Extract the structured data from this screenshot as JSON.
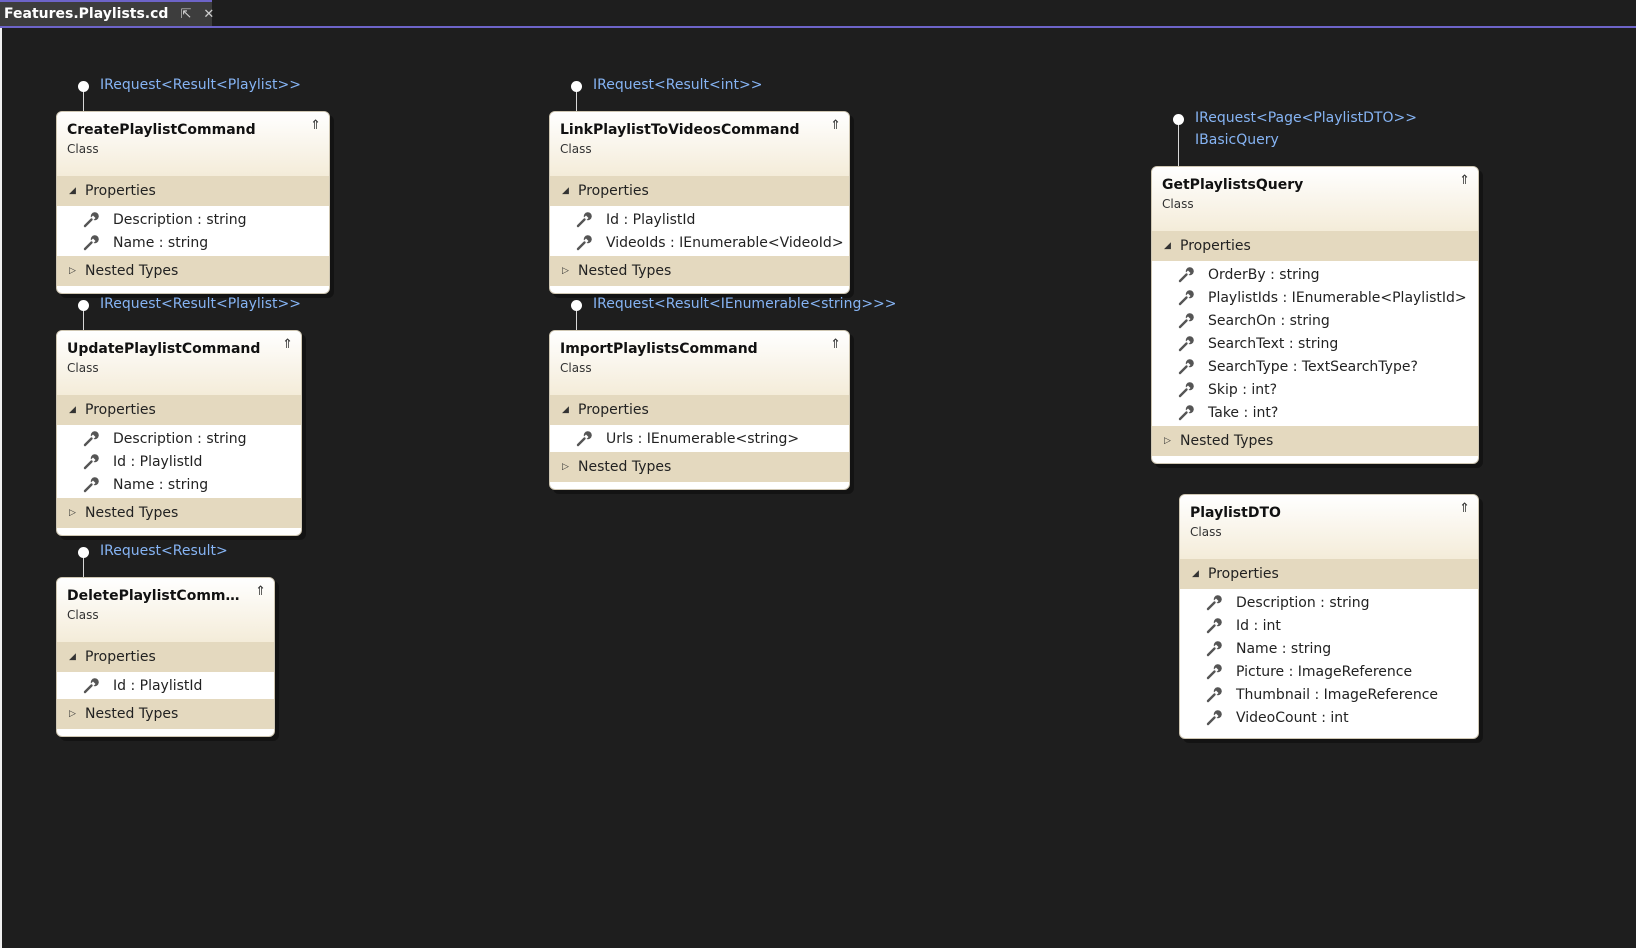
{
  "tab": {
    "title": "Features.Playlists.cd",
    "pin_glyph": "⇱",
    "close_glyph": "✕"
  },
  "icons": {
    "property": "wrench-icon",
    "collapse": "double-chevron-up-icon",
    "section_open": "triangle-down-icon",
    "section_closed": "triangle-right-icon"
  },
  "colors": {
    "background": "#1e1e1e",
    "interface_text": "#86b4f4",
    "section_band": "#e4d9bf",
    "tab_accent": "#6d64c8"
  },
  "labels": {
    "kind": "Class",
    "properties": "Properties",
    "nested_types": "Nested Types",
    "collapse_glyph": "⇑",
    "open_glyph": "◢",
    "closed_glyph": "▷"
  },
  "classes": [
    {
      "name": "CreatePlaylistCommand",
      "interfaces": [
        "IRequest<Result<Playlist>>"
      ],
      "properties": [
        "Description : string",
        "Name : string"
      ]
    },
    {
      "name": "UpdatePlaylistCommand",
      "interfaces": [
        "IRequest<Result<Playlist>>"
      ],
      "properties": [
        "Description : string",
        "Id : PlaylistId",
        "Name : string"
      ]
    },
    {
      "name": "DeletePlaylistComma...",
      "interfaces": [
        "IRequest<Result>"
      ],
      "properties": [
        "Id : PlaylistId"
      ]
    },
    {
      "name": "LinkPlaylistToVideosCommand",
      "interfaces": [
        "IRequest<Result<int>>"
      ],
      "properties": [
        "Id : PlaylistId",
        "VideoIds : IEnumerable<VideoId>"
      ]
    },
    {
      "name": "ImportPlaylistsCommand",
      "interfaces": [
        "IRequest<Result<IEnumerable<string>>>"
      ],
      "properties": [
        "Urls : IEnumerable<string>"
      ]
    },
    {
      "name": "GetPlaylistsQuery",
      "interfaces": [
        "IRequest<Page<PlaylistDTO>>",
        "IBasicQuery"
      ],
      "properties": [
        "OrderBy : string",
        "PlaylistIds : IEnumerable<PlaylistId>",
        "SearchOn : string",
        "SearchText : string",
        "SearchType : TextSearchType?",
        "Skip : int?",
        "Take : int?"
      ]
    },
    {
      "name": "PlaylistDTO",
      "interfaces": [],
      "properties": [
        "Description : string",
        "Id : int",
        "Name : string",
        "Picture : ImageReference",
        "Thumbnail : ImageReference",
        "VideoCount : int"
      ],
      "no_nested": true
    }
  ]
}
